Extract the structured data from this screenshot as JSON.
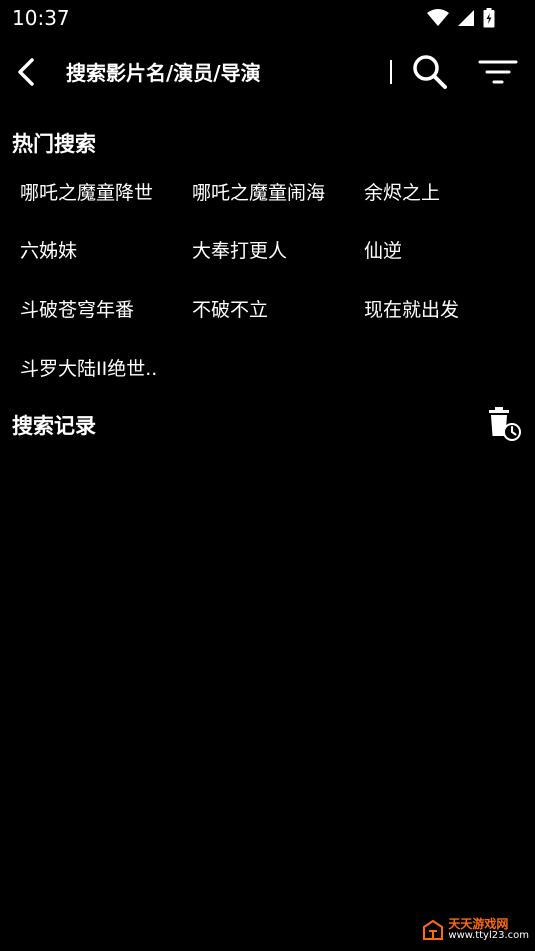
{
  "status_bar": {
    "time": "10:37"
  },
  "header": {
    "search_placeholder": "搜索影片名/演员/导演"
  },
  "hot_search": {
    "title": "热门搜索",
    "items": [
      "哪吒之魔童降世",
      "哪吒之魔童闹海",
      "余烬之上",
      "六姊妹",
      "大奉打更人",
      "仙逆",
      "斗破苍穹年番",
      "不破不立",
      "现在就出发",
      "斗罗大陆II绝世.."
    ]
  },
  "history": {
    "title": "搜索记录"
  },
  "watermark": {
    "title": "天天游戏网",
    "url": "www.ttyl23.com"
  },
  "colors": {
    "background": "#000000",
    "text": "#ffffff",
    "watermark_accent": "#ff6a13"
  }
}
